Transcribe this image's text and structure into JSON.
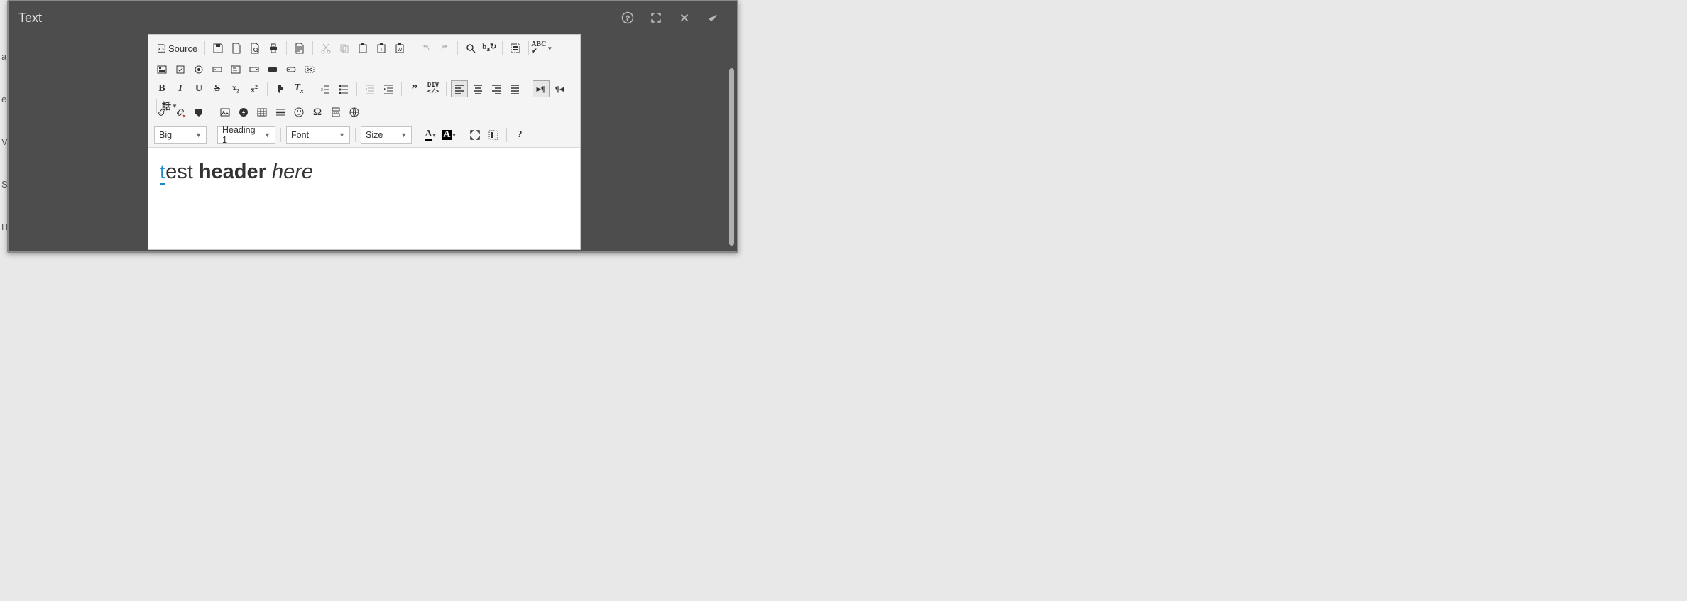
{
  "bg": [
    "a",
    "e",
    "",
    "",
    "V",
    "",
    "S",
    "",
    "H"
  ],
  "dialog": {
    "title": "Text"
  },
  "toolbar": {
    "source_label": "Source",
    "dropdowns": {
      "styles": "Big",
      "format": "Heading 1",
      "font": "Font",
      "size": "Size"
    }
  },
  "content": {
    "span1": "t",
    "span2": "est ",
    "span3": "header",
    "span4": " here"
  }
}
